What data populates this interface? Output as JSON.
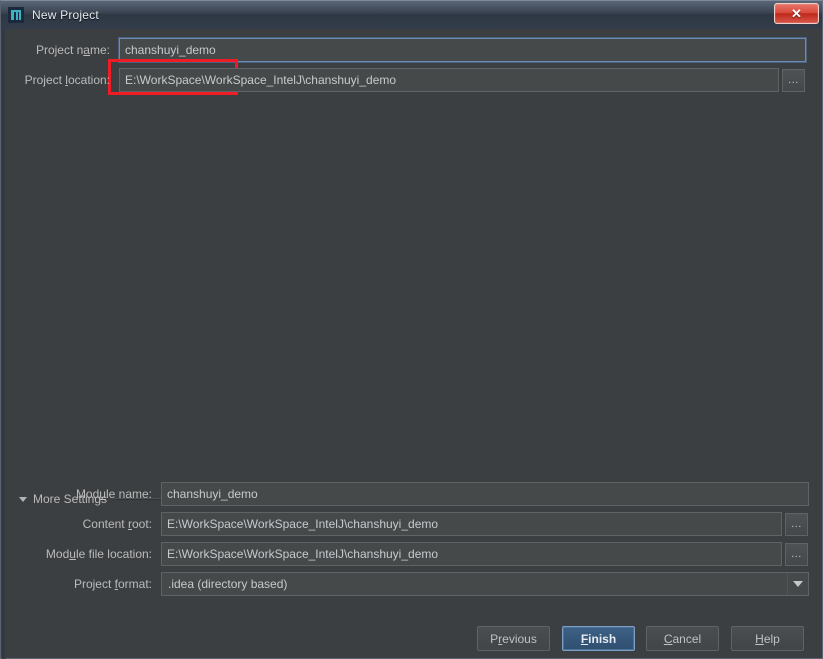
{
  "window": {
    "title": "New Project",
    "icon": "intellij-idea-icon",
    "close_label": "✕"
  },
  "form": {
    "project_name": {
      "label_pre": "Project n",
      "label_mnemonic": "a",
      "label_post": "me:",
      "label_full": "Project name:",
      "value": "chanshuyi_demo",
      "highlighted": true
    },
    "project_location": {
      "label_pre": "Project ",
      "label_mnemonic": "l",
      "label_post": "ocation:",
      "label_full": "Project location:",
      "value": "E:\\WorkSpace\\WorkSpace_IntelJ\\chanshuyi_demo",
      "browse_label": "..."
    }
  },
  "more_settings": {
    "label": "More Settings",
    "expanded": true,
    "toggle_icon": "triangle-down-icon",
    "fields": {
      "module_name": {
        "label_pre": "Mod",
        "label_mnemonic": "u",
        "label_post": "le name:",
        "label_full": "Module name:",
        "value": "chanshuyi_demo"
      },
      "content_root": {
        "label_pre": "Content ",
        "label_mnemonic": "r",
        "label_post": "oot:",
        "label_full": "Content root:",
        "value": "E:\\WorkSpace\\WorkSpace_IntelJ\\chanshuyi_demo",
        "browse_label": "..."
      },
      "module_file_location": {
        "label_pre": "Mod",
        "label_mnemonic": "u",
        "label_post": "le file location:",
        "label_full": "Module file location:",
        "value": "E:\\WorkSpace\\WorkSpace_IntelJ\\chanshuyi_demo",
        "browse_label": "..."
      },
      "project_format": {
        "label_pre": "Project ",
        "label_mnemonic": "f",
        "label_post": "ormat:",
        "label_full": "Project format:",
        "value": ".idea (directory based)",
        "arrow_icon": "chevron-down-icon"
      }
    }
  },
  "buttons": {
    "previous": {
      "pre": "P",
      "mnemonic": "r",
      "post": "evious",
      "full": "Previous"
    },
    "finish": {
      "pre": "",
      "mnemonic": "F",
      "post": "inish",
      "full": "Finish",
      "default": true
    },
    "cancel": {
      "pre": "",
      "mnemonic": "C",
      "post": "ancel",
      "full": "Cancel"
    },
    "help": {
      "pre": "",
      "mnemonic": "H",
      "post": "elp",
      "full": "Help"
    }
  },
  "colors": {
    "background": "#3c3f41",
    "field_background": "#45494a",
    "titlebar": "#343d4b",
    "accent_blue": "#365880",
    "highlight_red": "#ee1c25",
    "close_red": "#d8483a",
    "text": "#bbbbbb"
  }
}
